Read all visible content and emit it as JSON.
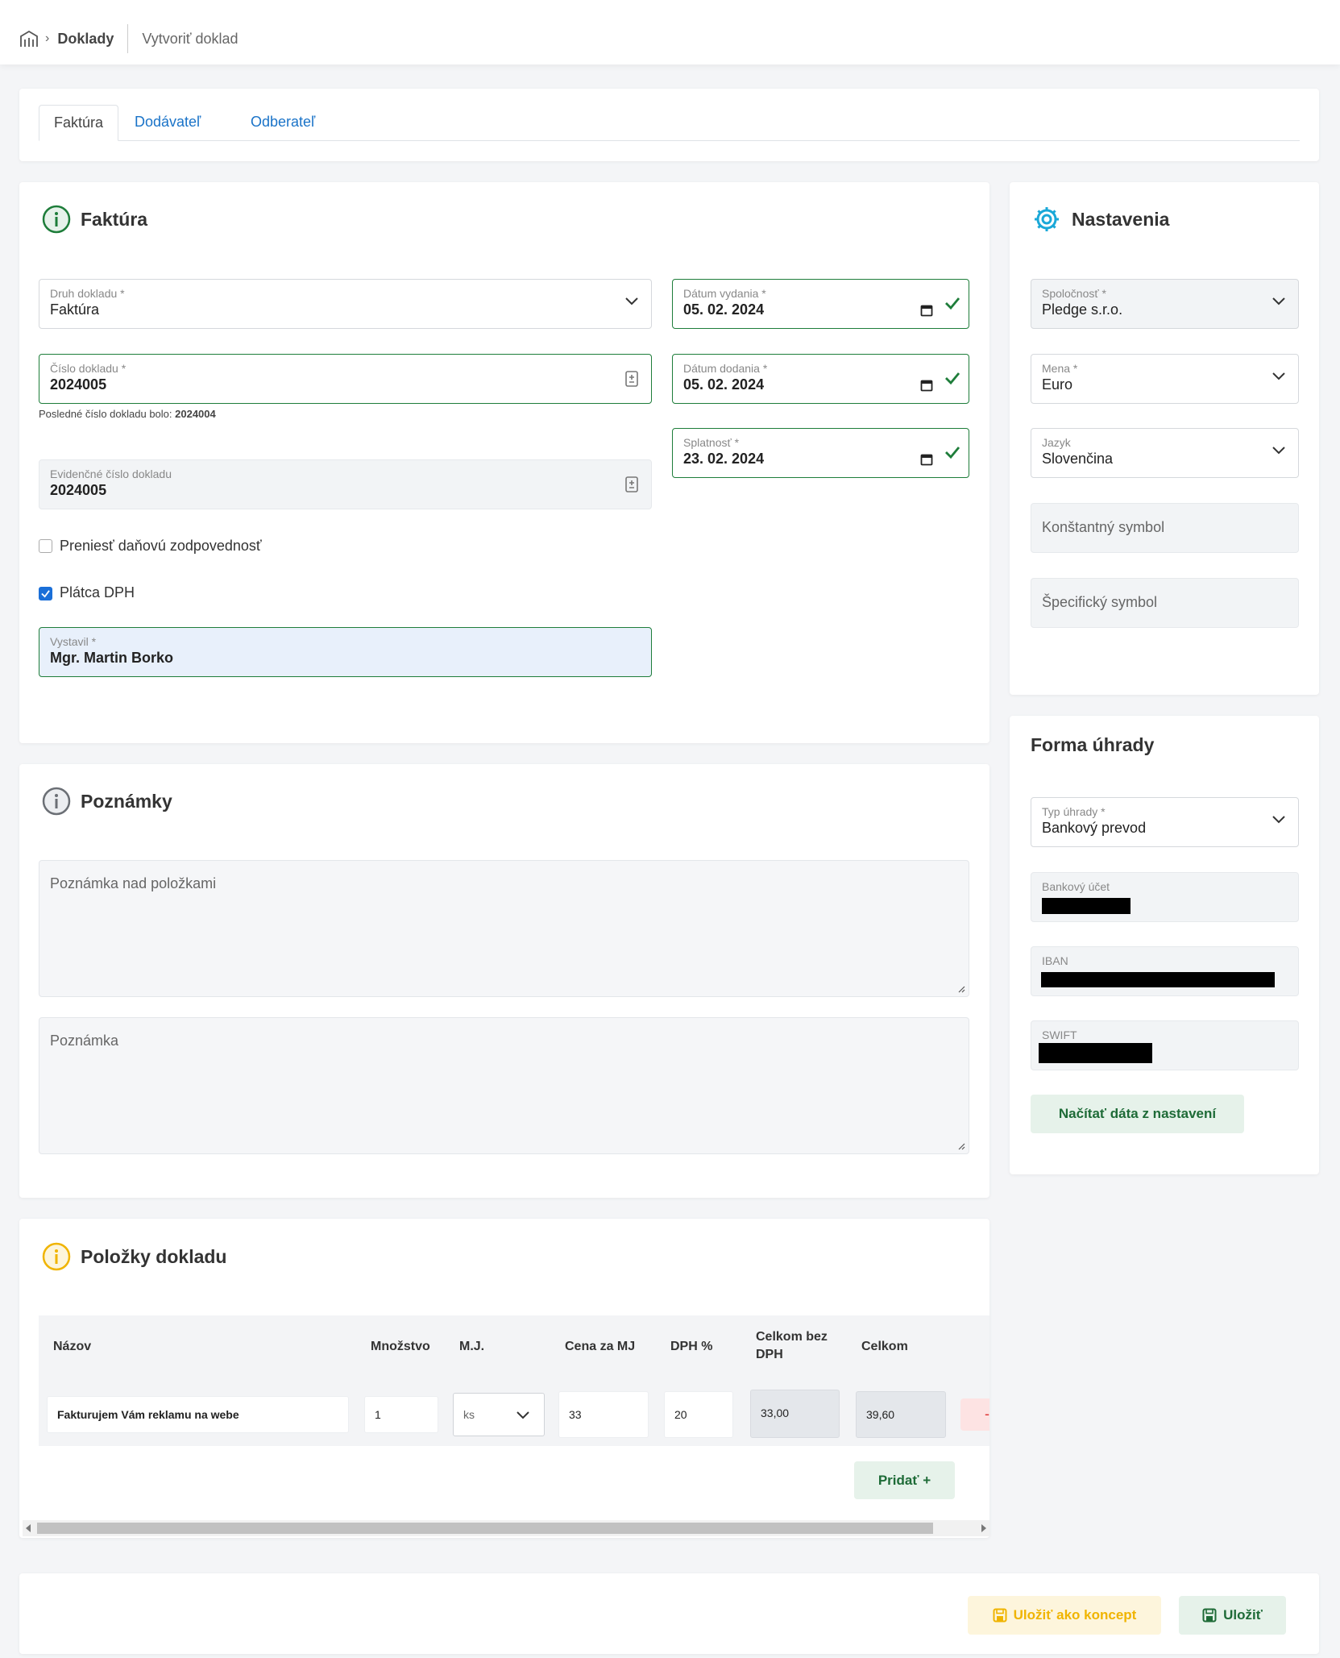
{
  "breadcrumb": {
    "home_icon": "building-icon",
    "section": "Doklady",
    "page": "Vytvoriť doklad"
  },
  "tabs": [
    {
      "label": "Faktúra",
      "active": true
    },
    {
      "label": "Dodávateľ",
      "active": false
    },
    {
      "label": "Odberateľ",
      "active": false
    }
  ],
  "invoice": {
    "title": "Faktúra",
    "doc_type": {
      "label": "Druh dokladu *",
      "value": "Faktúra"
    },
    "doc_number": {
      "label": "Číslo dokladu *",
      "value": "2024005",
      "hint_prefix": "Posledné číslo dokladu bolo:",
      "hint_value": "2024004"
    },
    "evid_number": {
      "label": "Evidenčné číslo dokladu",
      "value": "2024005"
    },
    "issue_date": {
      "label": "Dátum vydania *",
      "value": "05. 02. 2024"
    },
    "delivery_date": {
      "label": "Dátum dodania *",
      "value": "05. 02. 2024"
    },
    "due_date": {
      "label": "Splatnosť *",
      "value": "23. 02. 2024"
    },
    "reverse_charge": {
      "label": "Preniesť daňovú zodpovednosť",
      "checked": false
    },
    "vat_payer": {
      "label": "Plátca DPH",
      "checked": true
    },
    "issued_by": {
      "label": "Vystavil *",
      "value": "Mgr. Martin Borko"
    }
  },
  "settings": {
    "title": "Nastavenia",
    "company": {
      "label": "Spoločnosť *",
      "value": "Pledge s.r.o."
    },
    "currency": {
      "label": "Mena *",
      "value": "Euro"
    },
    "language": {
      "label": "Jazyk",
      "value": "Slovenčina"
    },
    "constant_symbol": "Konštantný symbol",
    "specific_symbol": "Špecifický symbol"
  },
  "payment": {
    "title": "Forma úhrady",
    "type": {
      "label": "Typ úhrady *",
      "value": "Bankový prevod"
    },
    "account_label": "Bankový účet",
    "iban_label": "IBAN",
    "swift_label": "SWIFT",
    "load_button": "Načítať dáta z nastavení"
  },
  "notes": {
    "title": "Poznámky",
    "above_items": "Poznámka nad položkami",
    "note": "Poznámka"
  },
  "items": {
    "title": "Položky dokladu",
    "headers": {
      "name": "Názov",
      "qty": "Množstvo",
      "unit": "M.J.",
      "price": "Cena za MJ",
      "vat": "DPH %",
      "net_1": "Celkom bez",
      "net_2": "DPH",
      "total": "Celkom"
    },
    "rows": [
      {
        "name": "Fakturujem  Vám reklamu na webe",
        "qty": "1",
        "unit": "ks",
        "price": "33",
        "vat": "20",
        "net": "33,00",
        "total": "39,60",
        "remove": "-"
      }
    ],
    "add_button": "Pridať +"
  },
  "footer": {
    "draft_button": "Uložiť ako koncept",
    "save_button": "Uložiť"
  },
  "colors": {
    "accent_green": "#1e7d3a",
    "link_blue": "#1a73c8",
    "gear_cyan": "#1aa8d8",
    "warn_yellow": "#f0b400"
  }
}
